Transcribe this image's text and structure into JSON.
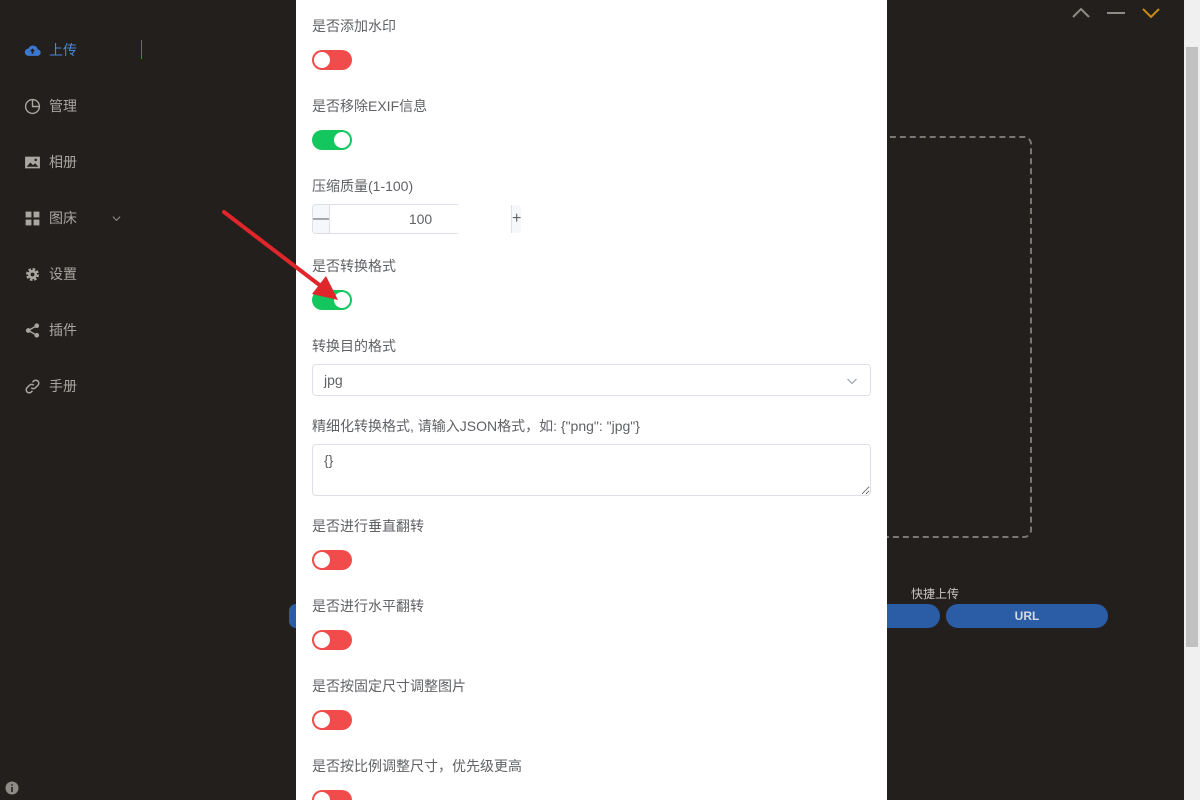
{
  "sidebar": {
    "items": [
      {
        "label": "上传",
        "icon": "cloud-upload-icon",
        "active": true
      },
      {
        "label": "管理",
        "icon": "pie-chart-icon"
      },
      {
        "label": "相册",
        "icon": "picture-icon"
      },
      {
        "label": "图床",
        "icon": "grid-icon",
        "expandable": true
      },
      {
        "label": "设置",
        "icon": "gear-icon"
      },
      {
        "label": "插件",
        "icon": "share-icon"
      },
      {
        "label": "手册",
        "icon": "link-icon"
      }
    ]
  },
  "window_controls": [
    "chevron-up-icon",
    "minimize-icon",
    "chevron-down-icon"
  ],
  "upload_page": {
    "quick_upload_label": "快捷上传",
    "url_button": "URL"
  },
  "dialog": {
    "watermark": {
      "label": "是否添加水印",
      "enabled": false
    },
    "remove_exif": {
      "label": "是否移除EXIF信息",
      "enabled": true
    },
    "quality": {
      "label": "压缩质量(1-100)",
      "value": "100",
      "dec_symbol": "—",
      "inc_symbol": "+"
    },
    "convert_format": {
      "label": "是否转换格式",
      "enabled": true
    },
    "target_format": {
      "label": "转换目的格式",
      "value": "jpg"
    },
    "format_mapping": {
      "label": "精细化转换格式, 请输入JSON格式，如: {\"png\": \"jpg\"}",
      "value": "{}"
    },
    "vertical_flip": {
      "label": "是否进行垂直翻转",
      "enabled": false
    },
    "horizontal_flip": {
      "label": "是否进行水平翻转",
      "enabled": false
    },
    "fixed_resize": {
      "label": "是否按固定尺寸调整图片",
      "enabled": false
    },
    "ratio_resize": {
      "label": "是否按比例调整尺寸，优先级更高",
      "enabled": false
    }
  },
  "colors": {
    "switch_on": "#13c65e",
    "switch_off": "#f14b4b",
    "accent_blue": "#2a5da6",
    "annotation_arrow": "#e0262b"
  }
}
